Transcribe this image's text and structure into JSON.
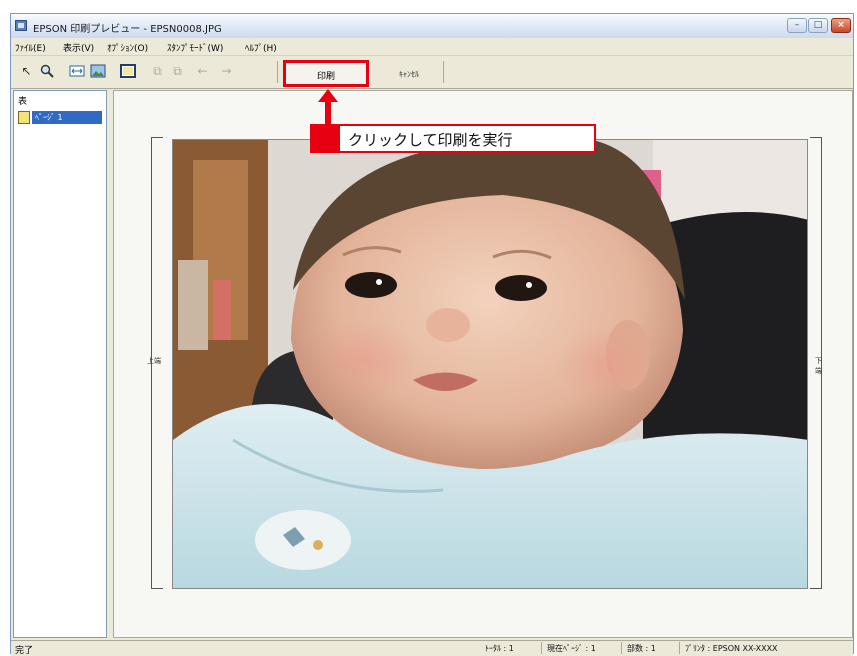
{
  "window": {
    "title": "EPSON 印刷プレビュー - EPSN0008.JPG",
    "controls": {
      "minimize": "–",
      "maximize": "□",
      "close": "×"
    }
  },
  "menu": {
    "items": [
      "ﾌｧｲﾙ(E)",
      "表示(V)",
      "ｵﾌﾟｼｮﾝ(O)",
      "ｽﾀﾝﾌﾟﾓｰﾄﾞ(W)",
      "ﾍﾙﾌﾟ(H)"
    ]
  },
  "toolbar": {
    "tools": [
      {
        "name": "pointer-icon",
        "glyph": "↖",
        "enabled": true
      },
      {
        "name": "zoom-icon",
        "glyph": "🔍",
        "enabled": true
      },
      {
        "name": "fit-page-icon",
        "glyph": "⤡",
        "enabled": true
      },
      {
        "name": "image-icon",
        "glyph": "▣",
        "enabled": true
      },
      {
        "name": "full-page-icon",
        "glyph": "▭",
        "enabled": true
      },
      {
        "name": "copy-icon",
        "glyph": "⧉",
        "enabled": false
      },
      {
        "name": "paste-icon",
        "glyph": "⧉",
        "enabled": false
      },
      {
        "name": "back-arrow-icon",
        "glyph": "←",
        "enabled": false
      },
      {
        "name": "forward-arrow-icon",
        "glyph": "→",
        "enabled": false
      }
    ],
    "print_label": "印刷",
    "cancel_label": "ｷｬﾝｾﾙ"
  },
  "tree": {
    "root_label": "表",
    "page_label": "ﾍﾟｰｼﾞ 1"
  },
  "preview": {
    "left_guide_label": "上端",
    "right_guide_label": "下端"
  },
  "annotation": {
    "text": "クリックして印刷を実行",
    "color": "#e60012"
  },
  "status": {
    "ready": "完了",
    "total_pages": "ﾄｰﾀﾙ : 1",
    "current_page": "現在ﾍﾟｰｼﾞ : 1",
    "copies": "部数 : 1",
    "printer": "ﾌﾟﾘﾝﾀ : EPSON XX-XXXX"
  }
}
